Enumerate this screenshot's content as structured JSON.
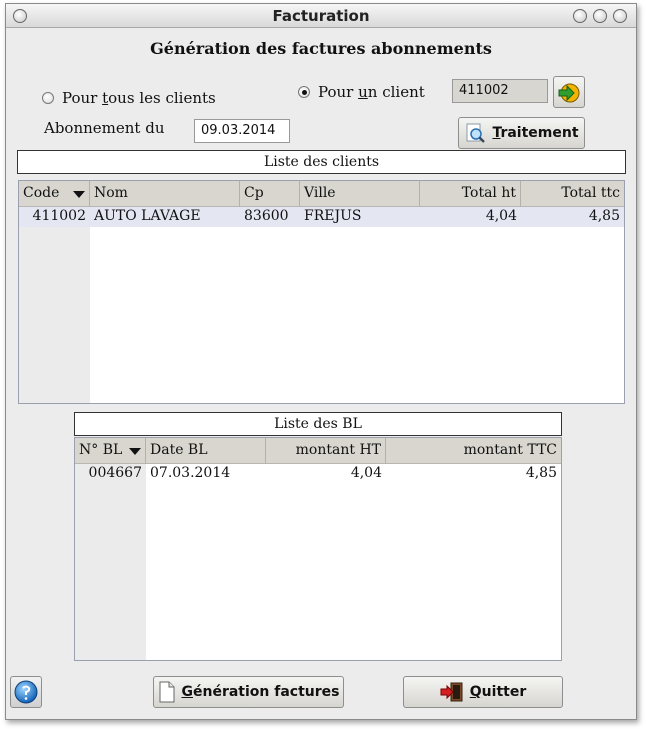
{
  "window": {
    "title": "Facturation"
  },
  "heading": "Génération des factures abonnements",
  "options": {
    "all_clients": {
      "label_pre": "Pour ",
      "label_u": "t",
      "label_post": "ous les clients",
      "checked": false
    },
    "one_client": {
      "label_pre": "Pour ",
      "label_u": "u",
      "label_post": "n client",
      "checked": true
    }
  },
  "client_code": "411002",
  "subscription": {
    "label": "Abonnement du",
    "date": "09.03.2014"
  },
  "buttons": {
    "traitement": {
      "u": "T",
      "rest": "raitement"
    },
    "generation": {
      "u": "G",
      "rest": "énération factures"
    },
    "quitter": {
      "u": "Q",
      "rest": "uitter"
    }
  },
  "clients_list": {
    "title": "Liste des clients",
    "columns": [
      "Code",
      "Nom",
      "Cp",
      "Ville",
      "Total ht",
      "Total ttc"
    ],
    "rows": [
      {
        "code": "411002",
        "nom": "AUTO LAVAGE",
        "cp": "83600",
        "ville": "FREJUS",
        "total_ht": "4,04",
        "total_ttc": "4,85"
      }
    ]
  },
  "bl_list": {
    "title": "Liste des BL",
    "columns": [
      "N° BL",
      "Date BL",
      "montant HT",
      "montant TTC"
    ],
    "rows": [
      {
        "num": "004667",
        "date": "07.03.2014",
        "montant_ht": "4,04",
        "montant_ttc": "4,85"
      }
    ]
  },
  "icons": {
    "go": "arrow-right-circle-icon",
    "search": "magnifier-icon",
    "document": "document-icon",
    "exit": "exit-door-icon",
    "help": "help-globe-icon"
  }
}
